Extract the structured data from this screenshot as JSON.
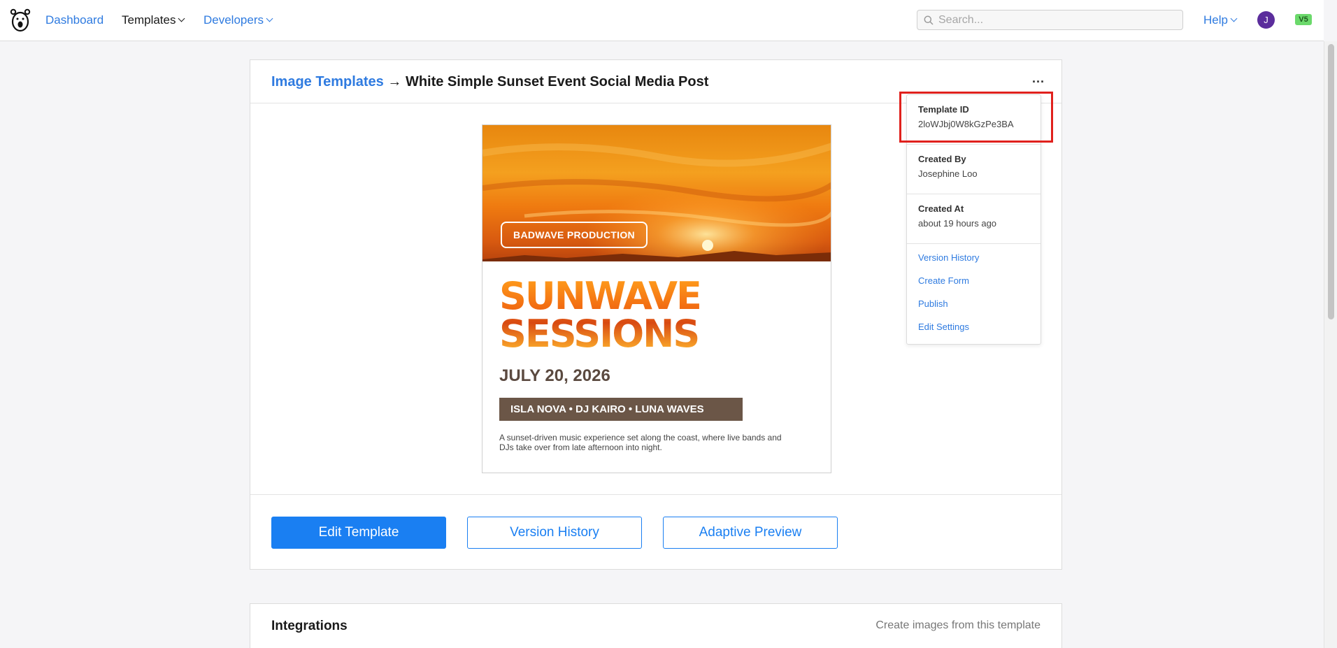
{
  "nav": {
    "dashboard": "Dashboard",
    "templates": "Templates",
    "developers": "Developers",
    "help": "Help",
    "search_placeholder": "Search...",
    "avatar_initial": "J",
    "version_badge": "V5"
  },
  "breadcrumb": {
    "parent": "Image Templates",
    "arrow": "→",
    "title": "White Simple Sunset Event Social Media Post"
  },
  "more_menu": "...",
  "poster": {
    "badge": "BADWAVE PRODUCTION",
    "title_line1": "SUNWAVE",
    "title_line2": "SESSIONS",
    "date": "JULY 20, 2026",
    "artists": "ISLA NOVA • DJ KAIRO • LUNA WAVES",
    "description": "A sunset-driven music experience set along the coast, where live bands and DJs take over from late afternoon into night."
  },
  "buttons": {
    "edit": "Edit Template",
    "history": "Version History",
    "preview": "Adaptive Preview"
  },
  "info_panel": {
    "template_id_label": "Template ID",
    "template_id": "2loWJbj0W8kGzPe3BA",
    "created_by_label": "Created By",
    "created_by": "Josephine Loo",
    "created_at_label": "Created At",
    "created_at": "about 19 hours ago",
    "links": [
      "Version History",
      "Create Form",
      "Publish",
      "Edit Settings"
    ]
  },
  "integrations": {
    "title": "Integrations",
    "subtitle": "Create images from this template"
  },
  "colors": {
    "link": "#2f7be0",
    "primary_button": "#1a7ff2",
    "highlight": "#e0211d",
    "artist_bar": "#6b5647"
  }
}
